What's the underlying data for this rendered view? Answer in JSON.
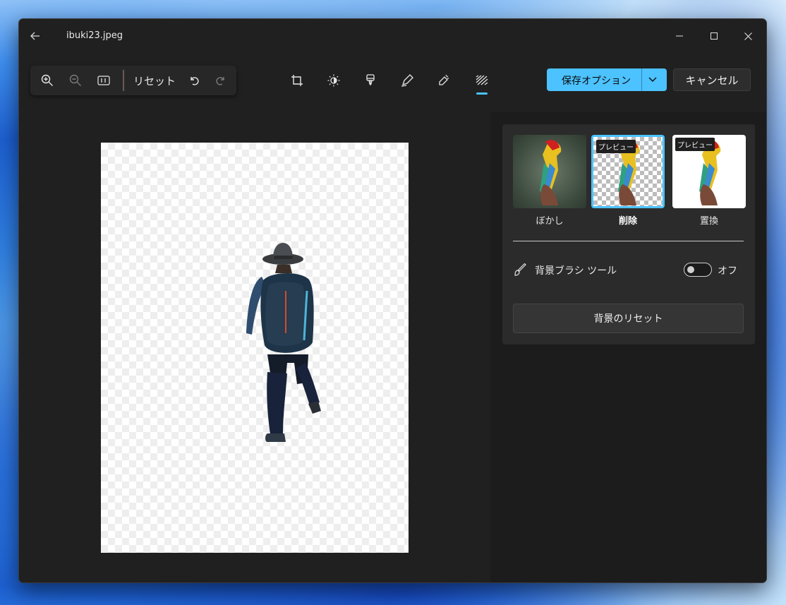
{
  "window": {
    "title": "ibuki23.jpeg"
  },
  "zoom_toolbar": {
    "reset_label": "リセット"
  },
  "edit_tools": {
    "items": [
      "crop-icon",
      "adjust-brightness-icon",
      "filter-icon",
      "markup-icon",
      "retouch-icon",
      "background-icon"
    ],
    "active": "background-icon"
  },
  "actions": {
    "save_label": "保存オプション",
    "cancel_label": "キャンセル"
  },
  "background_panel": {
    "options": [
      {
        "label": "ぼかし",
        "badge": ""
      },
      {
        "label": "削除",
        "badge": "プレビュー",
        "selected": true
      },
      {
        "label": "置換",
        "badge": "プレビュー"
      }
    ],
    "brush_tool_label": "背景ブラシ ツール",
    "brush_toggle_state": "オフ",
    "reset_button_label": "背景のリセット"
  },
  "colors": {
    "accent": "#4cc2ff",
    "window_bg": "#202020",
    "panel_bg": "#2b2b2b"
  }
}
